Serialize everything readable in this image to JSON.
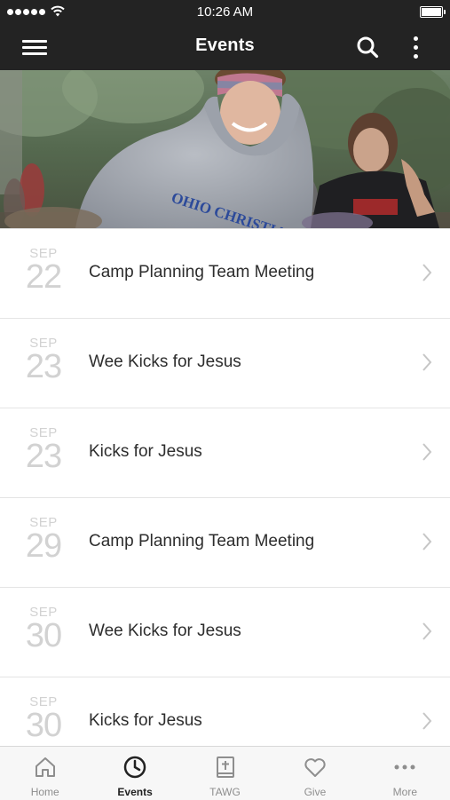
{
  "status_bar": {
    "time": "10:26 AM"
  },
  "nav": {
    "title": "Events"
  },
  "events": [
    {
      "month": "SEP",
      "day": "22",
      "title": "Camp Planning Team Meeting"
    },
    {
      "month": "SEP",
      "day": "23",
      "title": "Wee Kicks for Jesus"
    },
    {
      "month": "SEP",
      "day": "23",
      "title": "Kicks for Jesus"
    },
    {
      "month": "SEP",
      "day": "29",
      "title": "Camp Planning Team Meeting"
    },
    {
      "month": "SEP",
      "day": "30",
      "title": "Wee Kicks for Jesus"
    },
    {
      "month": "SEP",
      "day": "30",
      "title": "Kicks for Jesus"
    }
  ],
  "hero": {
    "shirt_text": "OHIO CHRISTIAN"
  },
  "tabbar": {
    "tabs": [
      {
        "label": "Home",
        "icon": "home-icon"
      },
      {
        "label": "Events",
        "icon": "clock-icon",
        "active": true
      },
      {
        "label": "TAWG",
        "icon": "bible-icon"
      },
      {
        "label": "Give",
        "icon": "heart-icon"
      },
      {
        "label": "More",
        "icon": "ellipsis-icon"
      }
    ]
  },
  "colors": {
    "header_bg": "#232323",
    "date_text": "#d2d2d2",
    "title_text": "#2d2d2d",
    "tab_inactive": "#8e8e8e",
    "tab_active": "#222222"
  }
}
